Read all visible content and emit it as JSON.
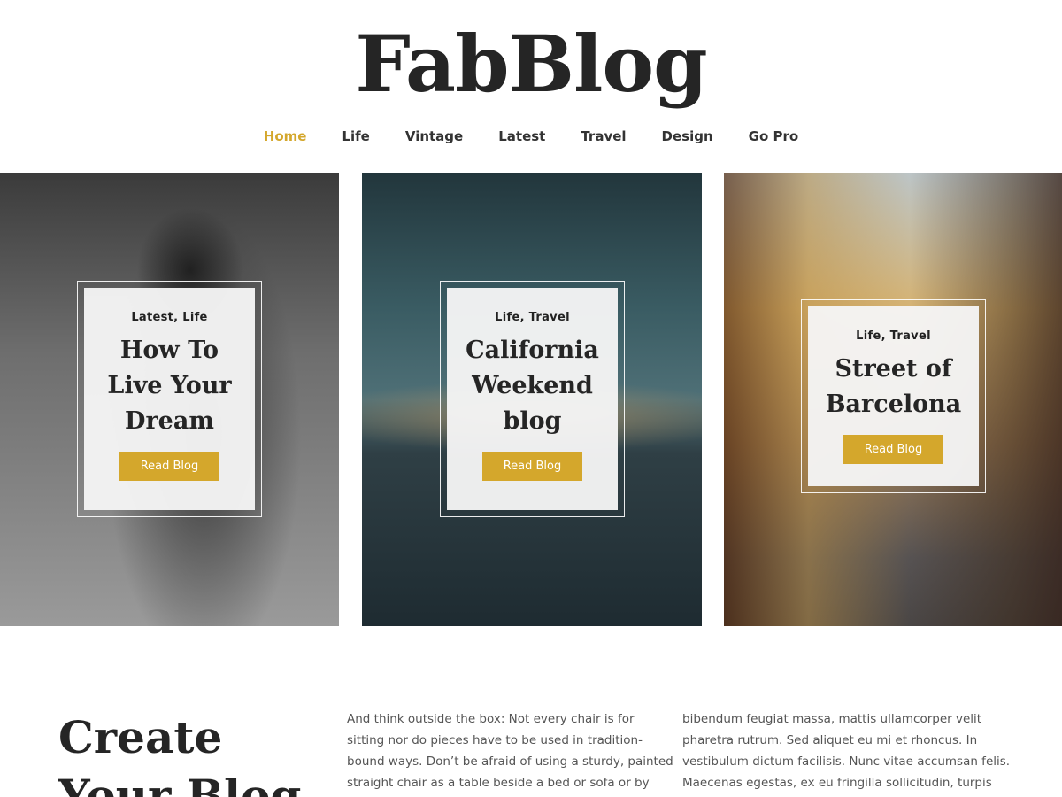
{
  "site": {
    "title": "FabBlog"
  },
  "nav": {
    "items": [
      {
        "label": "Home",
        "active": true
      },
      {
        "label": "Life",
        "active": false
      },
      {
        "label": "Vintage",
        "active": false
      },
      {
        "label": "Latest",
        "active": false
      },
      {
        "label": "Travel",
        "active": false
      },
      {
        "label": "Design",
        "active": false
      },
      {
        "label": "Go Pro",
        "active": false
      }
    ]
  },
  "colors": {
    "accent": "#d4a72c",
    "text": "#252525"
  },
  "posts": [
    {
      "categories": "Latest, Life",
      "title": "How To Live Your Dream",
      "button": "Read Blog",
      "image": "woman-in-hat-photo"
    },
    {
      "categories": "Life, Travel",
      "title": "California Weekend blog",
      "button": "Read Blog",
      "image": "ocean-sunset-photo"
    },
    {
      "categories": "Life, Travel",
      "title": "Street of Barcelona",
      "button": "Read Blog",
      "image": "barcelona-street-photo"
    }
  ],
  "about": {
    "heading": "Create Your Blog",
    "column1": "And think outside the box: Not every chair is for sitting nor do pieces have to be used in tradition-bound ways. Don’t be afraid of using a sturdy, painted straight chair as a table beside a bed or sofa or by",
    "column2": "bibendum feugiat massa, mattis ullamcorper velit pharetra rutrum. Sed aliquet eu mi et rhoncus. In vestibulum dictum facilisis. Nunc vitae accumsan felis. Maecenas egestas, ex eu fringilla sollicitudin, turpis"
  }
}
